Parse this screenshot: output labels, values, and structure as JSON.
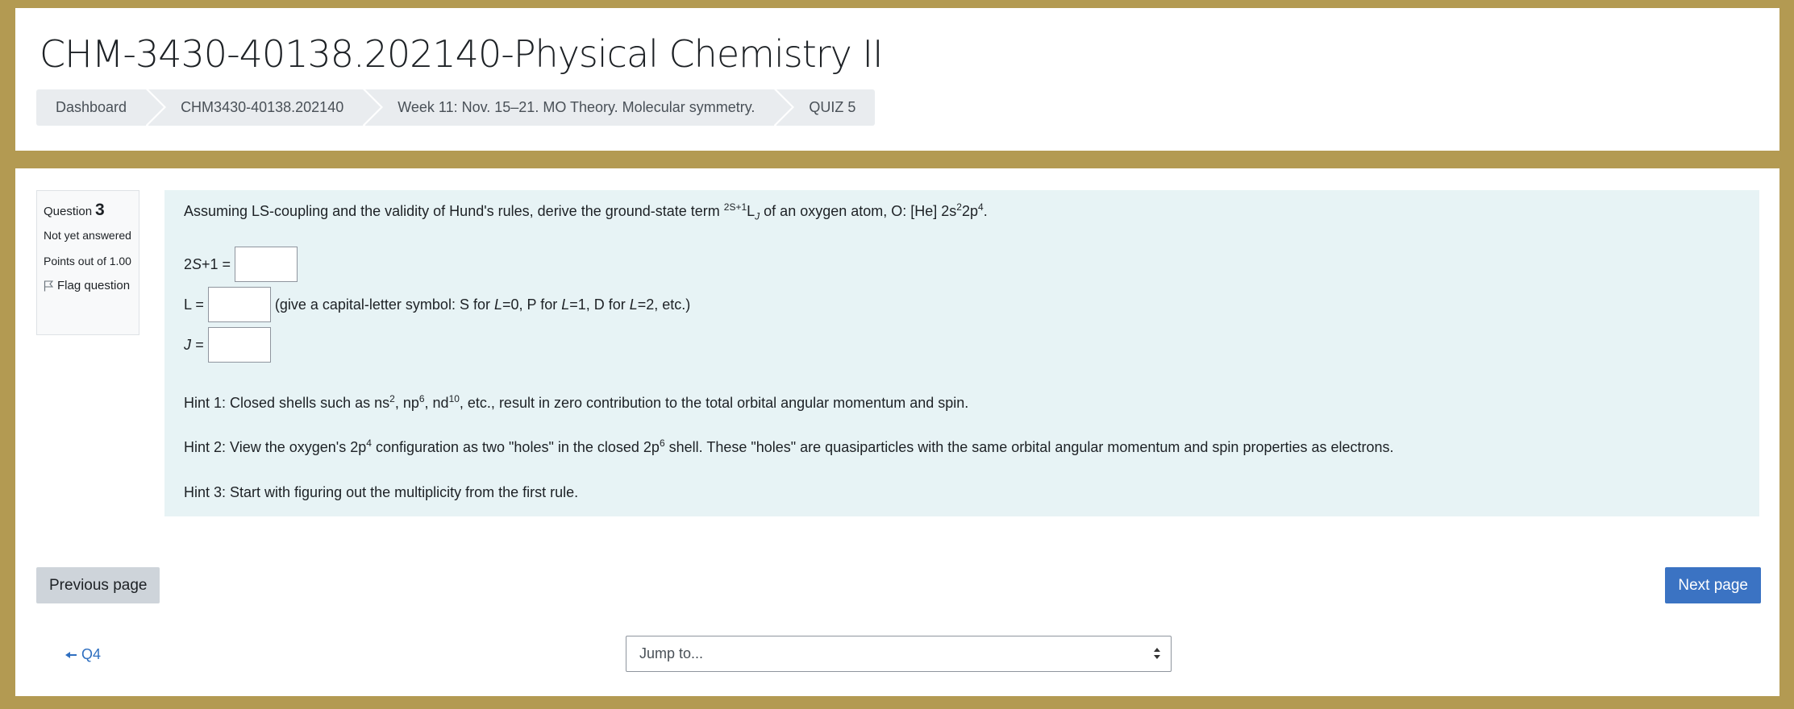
{
  "header": {
    "course_title": "CHM-3430-40138.202140-Physical Chemistry II",
    "breadcrumb": [
      "Dashboard",
      "CHM3430-40138.202140",
      "Week 11: Nov. 15–21. MO Theory. Molecular symmetry.",
      "QUIZ 5"
    ]
  },
  "question_info": {
    "question_label": "Question",
    "question_number": "3",
    "state": "Not yet answered",
    "grade": "Points out of 1.00",
    "flag_label": "Flag question"
  },
  "question": {
    "text_pre": "Assuming LS-coupling and the validity of Hund's rules, derive the ground-state term ",
    "term_sup": "2S+1",
    "term_L": "L",
    "term_sub": "J",
    "text_post": " of an oxygen atom, O: [He] 2s",
    "config_sup1": "2",
    "config_mid": "2p",
    "config_sup2": "4",
    "config_end": ".",
    "field1_label": "2S+1 =",
    "field2_label": "L =",
    "field2_note": "(give a capital-letter symbol: S for L=0, P for L=1, D for L=2, etc.)",
    "field3_label": "J =",
    "hint1": "Hint 1: Closed shells such as ns2, np6, nd10, etc., result in zero contribution to the total orbital angular momentum and spin.",
    "hint2": "Hint 2: View the oxygen's 2p4 configuration as two \"holes\" in the closed 2p6 shell. These \"holes\" are quasiparticles with the same orbital angular momentum and spin properties as electrons.",
    "hint3": "Hint 3: Start with figuring out the multiplicity from the first rule."
  },
  "navigation": {
    "prev_label": "Previous page",
    "next_label": "Next page",
    "back_link": "Q4",
    "jump_placeholder": "Jump to..."
  }
}
